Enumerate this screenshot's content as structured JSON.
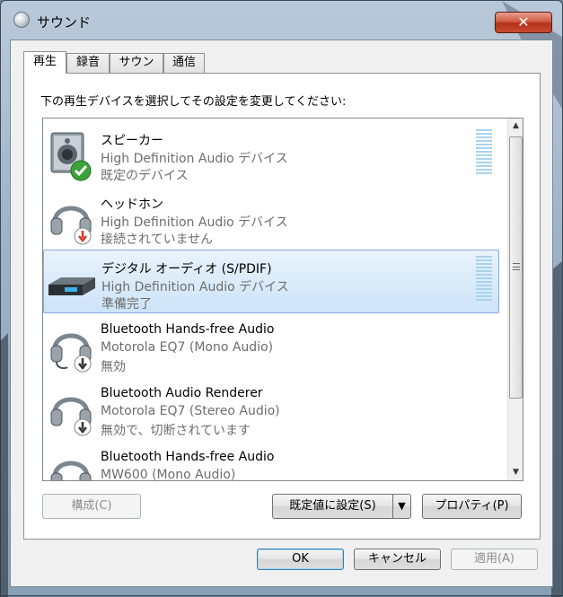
{
  "window": {
    "title": "サウンド",
    "close_label": "✕"
  },
  "tabs": [
    {
      "label": "再生"
    },
    {
      "label": "録音"
    },
    {
      "label": "サウンド"
    },
    {
      "label": "通信"
    }
  ],
  "instruction": "下の再生デバイスを選択してその設定を変更してください:",
  "devices": [
    {
      "name": "スピーカー",
      "subtitle": "High Definition Audio デバイス",
      "status": "既定のデバイス",
      "icon": "speaker-icon",
      "badge": "default-check-icon"
    },
    {
      "name": "ヘッドホン",
      "subtitle": "High Definition Audio デバイス",
      "status": "接続されていません",
      "icon": "headphones-icon",
      "badge": "unplugged-icon"
    },
    {
      "name": "デジタル オーディオ (S/PDIF)",
      "subtitle": "High Definition Audio デバイス",
      "status": "準備完了",
      "icon": "digital-audio-icon"
    },
    {
      "name": "Bluetooth Hands-free Audio",
      "subtitle": "Motorola EQ7 (Mono Audio)",
      "status": "無効",
      "icon": "headset-icon",
      "badge": "disabled-icon"
    },
    {
      "name": "Bluetooth Audio Renderer",
      "subtitle": "Motorola EQ7 (Stereo Audio)",
      "status": "無効で、切断されています",
      "icon": "headphones-icon",
      "badge": "disabled-icon"
    },
    {
      "name": "Bluetooth Hands-free Audio",
      "subtitle": "MW600 (Mono Audio)",
      "status": "",
      "icon": "headset-icon"
    }
  ],
  "buttons": {
    "configure": "構成(C)",
    "set_default": "既定値に設定(S)",
    "properties": "プロパティ(P)",
    "ok": "OK",
    "cancel": "キャンセル",
    "apply": "適用(A)"
  },
  "colors": {
    "selection": "#cde3f8",
    "meter": "#a9d3ee",
    "check": "#3aa33a",
    "warning": "#d23a2a"
  }
}
